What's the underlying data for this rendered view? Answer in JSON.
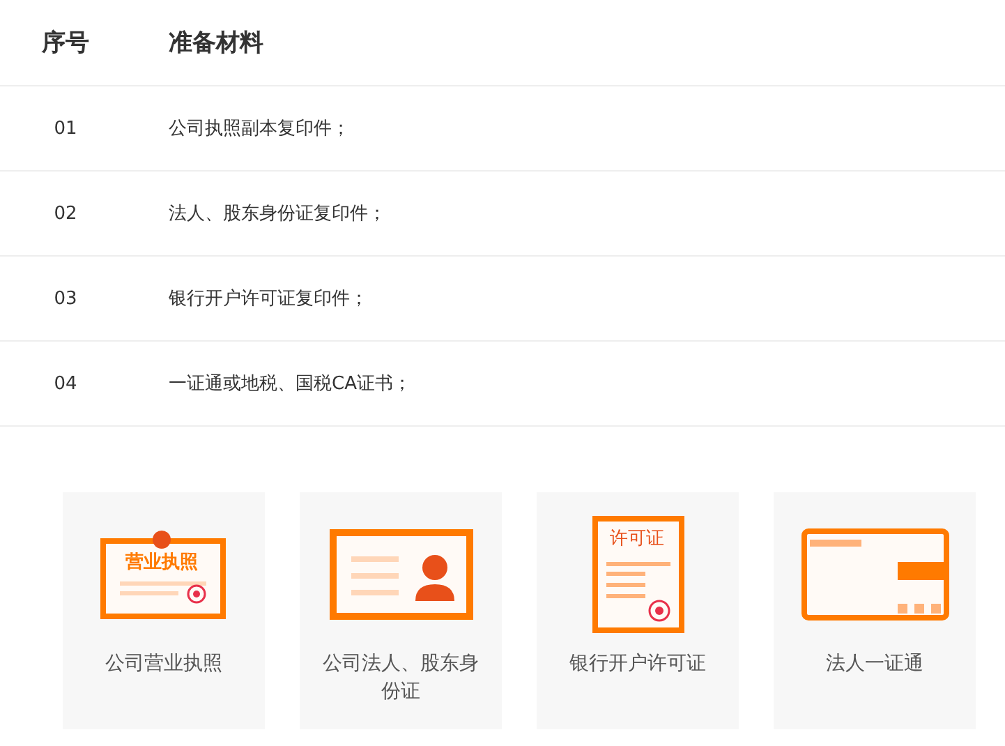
{
  "table": {
    "columns": [
      "序号",
      "准备材料"
    ],
    "rows": [
      {
        "number": "01",
        "material": "公司执照副本复印件；"
      },
      {
        "number": "02",
        "material": "法人、股东身份证复印件；"
      },
      {
        "number": "03",
        "material": "银行开户许可证复印件；"
      },
      {
        "number": "04",
        "material": "一证通或地税、国税CA证书；"
      }
    ]
  },
  "cards": [
    {
      "kind": "license",
      "icon_text": "营业执照",
      "label": "公司营业执照"
    },
    {
      "kind": "id",
      "label": "公司法人、股东身份证"
    },
    {
      "kind": "permit",
      "icon_text": "许可证",
      "label": "银行开户许可证"
    },
    {
      "kind": "cert",
      "label": "法人一证通"
    }
  ]
}
